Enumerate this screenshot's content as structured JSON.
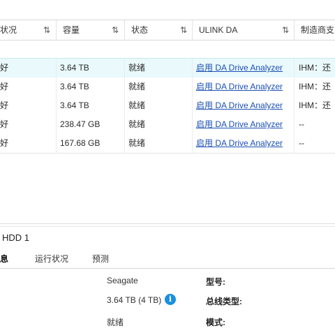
{
  "table": {
    "columns": [
      {
        "label": "状况"
      },
      {
        "label": "容量"
      },
      {
        "label": "状态"
      },
      {
        "label": "ULINK DA"
      },
      {
        "label": "制造商支"
      }
    ],
    "sort_glyph": "⇅",
    "rows": [
      {
        "health": "好",
        "capacity": "3.64 TB",
        "status": "就绪",
        "ulink": "启用 DA Drive Analyzer",
        "vendor": "IHM：还"
      },
      {
        "health": "好",
        "capacity": "3.64 TB",
        "status": "就绪",
        "ulink": "启用 DA Drive Analyzer",
        "vendor": "IHM：还"
      },
      {
        "health": "好",
        "capacity": "3.64 TB",
        "status": "就绪",
        "ulink": "启用 DA Drive Analyzer",
        "vendor": "IHM：还"
      },
      {
        "health": "好",
        "capacity": "238.47 GB",
        "status": "就绪",
        "ulink": "启用 DA Drive Analyzer",
        "vendor": "--"
      },
      {
        "health": "好",
        "capacity": "167.68 GB",
        "status": "就绪",
        "ulink": "启用 DA Drive Analyzer",
        "vendor": "--"
      }
    ]
  },
  "details": {
    "title": "HDD 1",
    "tabs": [
      {
        "label": "信息"
      },
      {
        "label": "运行状况"
      },
      {
        "label": "预测"
      }
    ],
    "values": {
      "manufacturer": "Seagate",
      "capacity": "3.64 TB (4 TB)",
      "status": "就绪"
    },
    "labels": {
      "model": "型号:",
      "bus_type": "总线类型:",
      "mode": "模式:"
    },
    "info_glyph": "i"
  },
  "colors": {
    "selected_row": "#eaf9fb",
    "link": "#1a4fb5",
    "info_icon": "#1a8fe0"
  }
}
